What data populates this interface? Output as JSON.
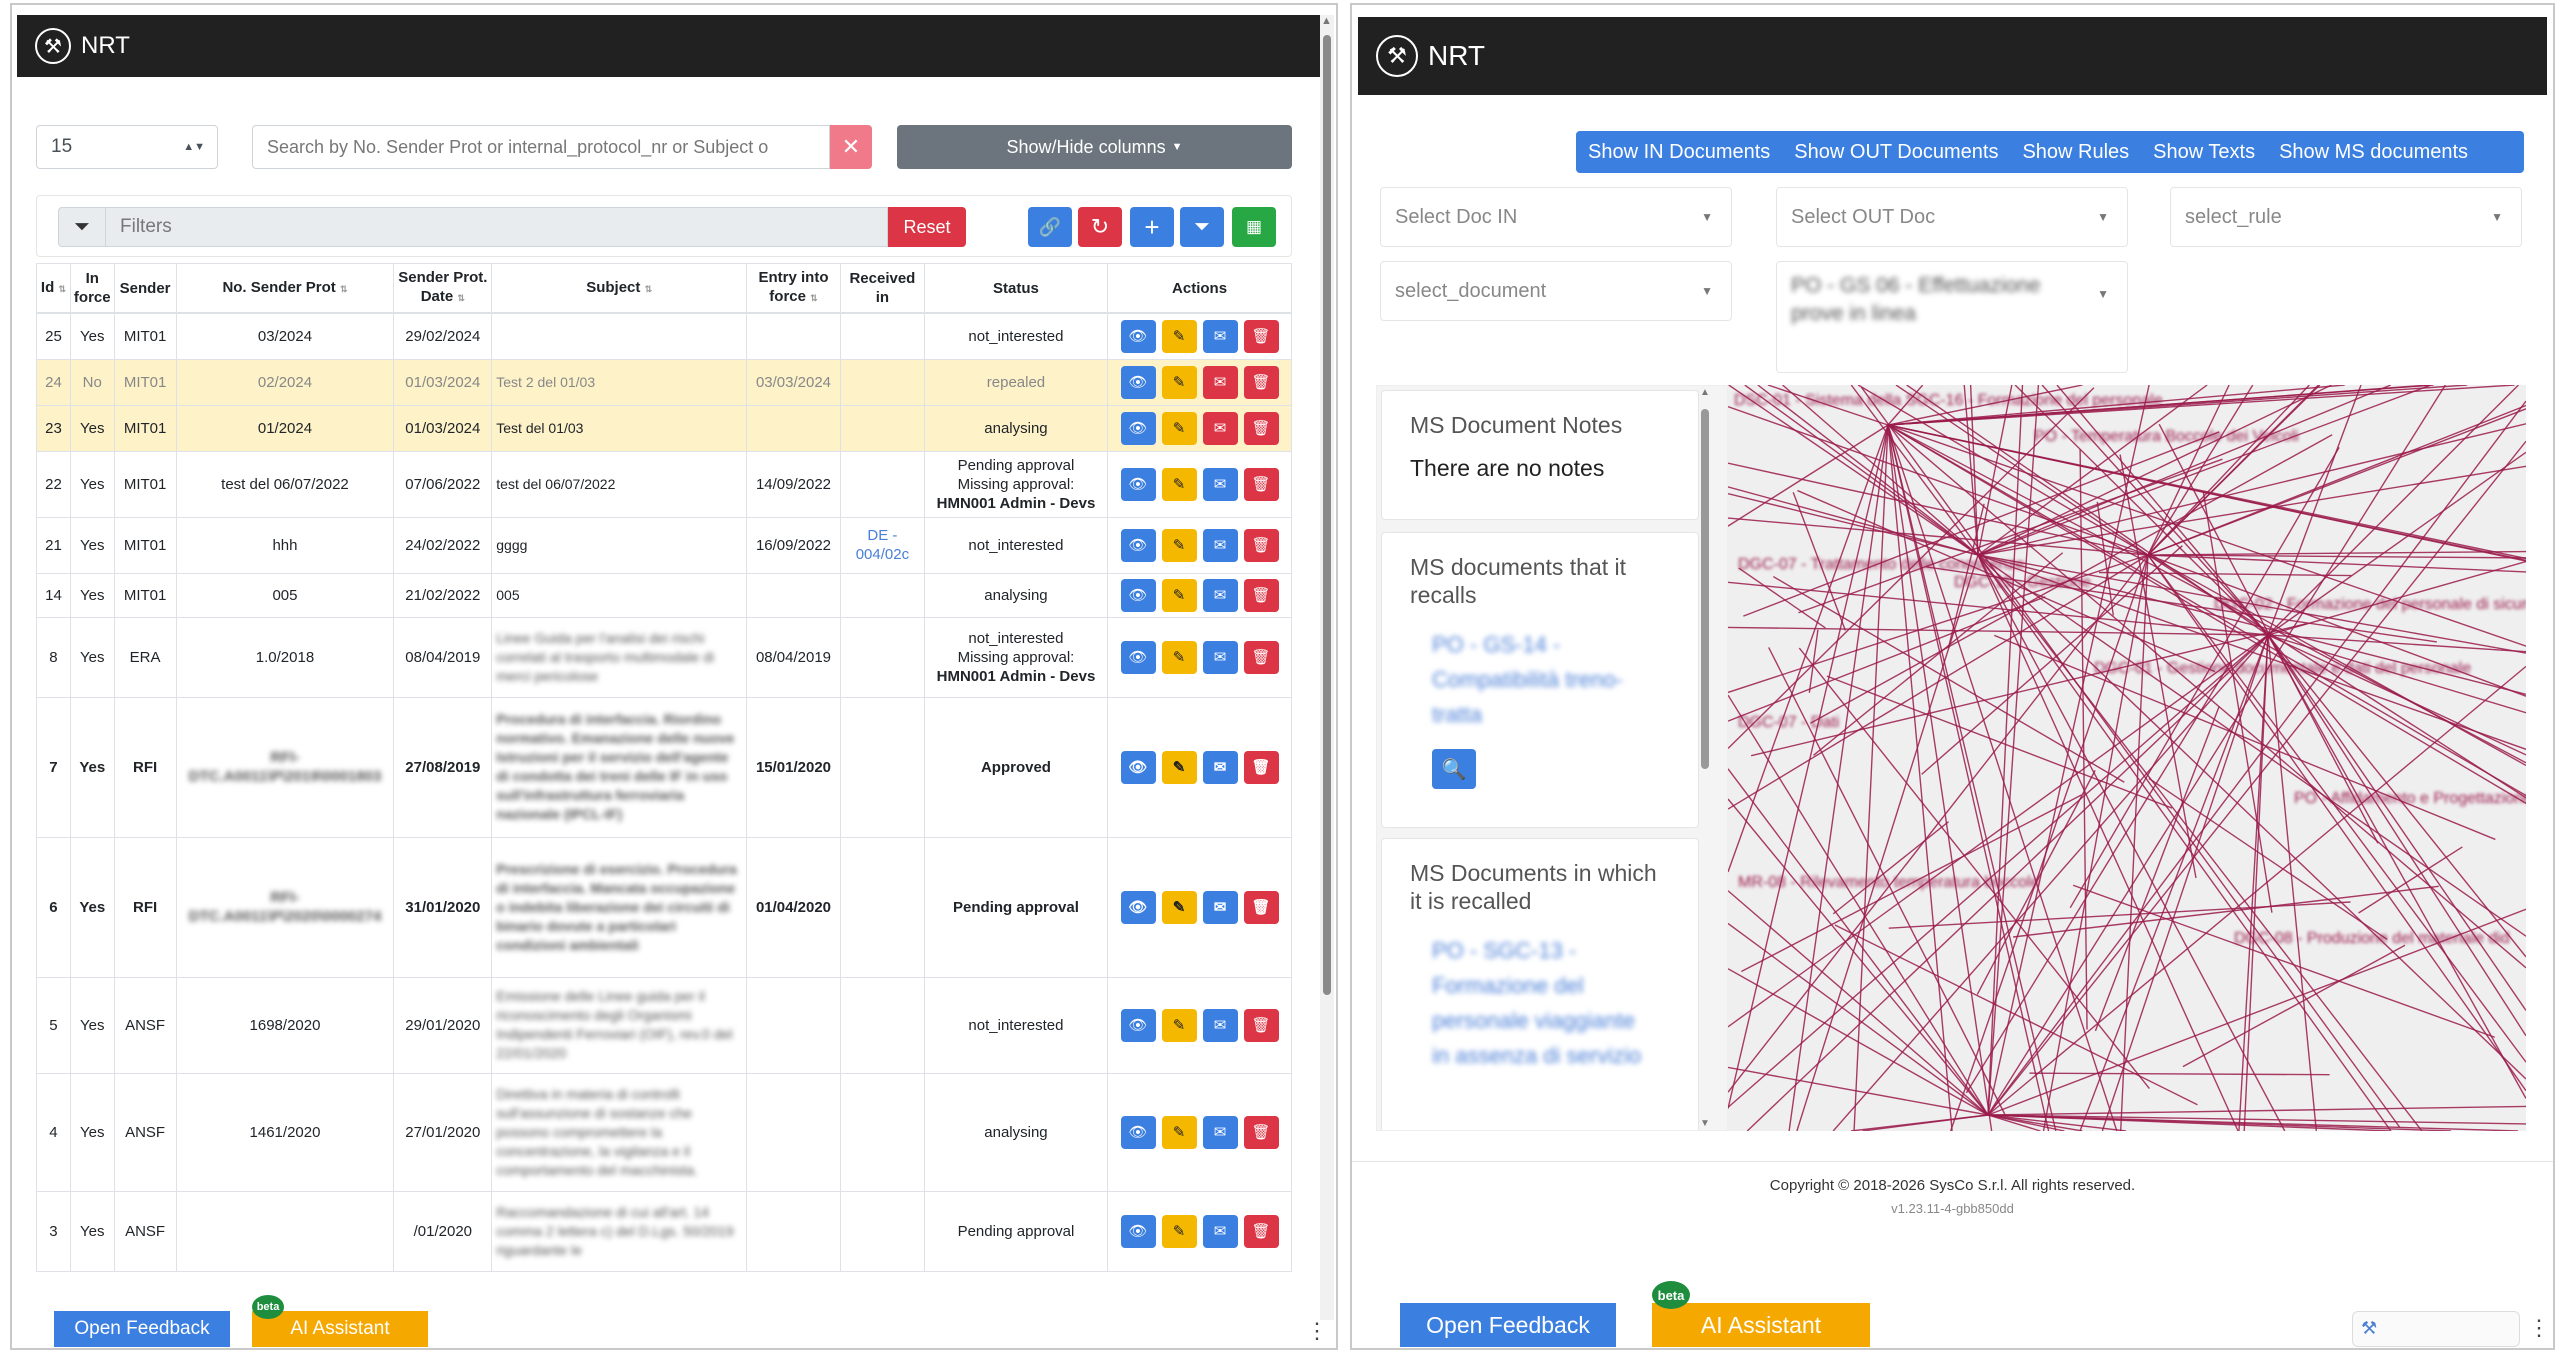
{
  "left": {
    "brand": "NRT",
    "page_size": "15",
    "search_placeholder": "Search by No. Sender Prot or internal_protocol_nr or Subject o",
    "show_hide_label": "Show/Hide columns",
    "filters_placeholder": "Filters",
    "reset_label": "Reset",
    "columns": [
      "Id",
      "In force",
      "Sender",
      "No. Sender Prot",
      "Sender Prot. Date",
      "Subject",
      "Entry into force",
      "Received in",
      "Status",
      "Actions"
    ],
    "rows": [
      {
        "id": "25",
        "inforce": "Yes",
        "sender": "MIT01",
        "prot": "03/2024",
        "date": "29/02/2024",
        "subject": "",
        "entry": "",
        "received": "",
        "status": "not_interested",
        "status2": "",
        "status3": ""
      },
      {
        "id": "24",
        "inforce": "No",
        "sender": "MIT01",
        "prot": "02/2024",
        "date": "01/03/2024",
        "subject": "Test 2 del 01/03",
        "entry": "03/03/2024",
        "received": "",
        "status": "repealed",
        "status2": "",
        "status3": ""
      },
      {
        "id": "23",
        "inforce": "Yes",
        "sender": "MIT01",
        "prot": "01/2024",
        "date": "01/03/2024",
        "subject": "Test del 01/03",
        "entry": "",
        "received": "",
        "status": "analysing",
        "status2": "",
        "status3": ""
      },
      {
        "id": "22",
        "inforce": "Yes",
        "sender": "MIT01",
        "prot": "test del 06/07/2022",
        "date": "07/06/2022",
        "subject": "test del 06/07/2022",
        "entry": "14/09/2022",
        "received": "",
        "status": "Pending approval",
        "status2": "Missing approval:",
        "status3": "HMN001 Admin - Devs"
      },
      {
        "id": "21",
        "inforce": "Yes",
        "sender": "MIT01",
        "prot": "hhh",
        "date": "24/02/2022",
        "subject": "gggg",
        "entry": "16/09/2022",
        "received": "DE - 004/02c",
        "status": "not_interested",
        "status2": "",
        "status3": ""
      },
      {
        "id": "14",
        "inforce": "Yes",
        "sender": "MIT01",
        "prot": "005",
        "date": "21/02/2022",
        "subject": "005",
        "entry": "",
        "received": "",
        "status": "analysing",
        "status2": "",
        "status3": ""
      },
      {
        "id": "8",
        "inforce": "Yes",
        "sender": "ERA",
        "prot": "1.0/2018",
        "date": "08/04/2019",
        "subject": "Linee Guida per l'analisi dei rischi correlati al trasporto multimodale di merci pericolose",
        "entry": "08/04/2019",
        "received": "",
        "status": "not_interested",
        "status2": "Missing approval:",
        "status3": "HMN001 Admin - Devs"
      },
      {
        "id": "7",
        "inforce": "Yes",
        "sender": "RFI",
        "prot": "RFI-DTC.A0011\\P\\2019\\0001803",
        "date": "27/08/2019",
        "subject": "Procedura di interfaccia. Riordino normativo. Emanazione delle nuove Istruzioni per il servizio dell'agente di condotta dei treni delle IF in uso sull'infrastruttura ferroviaria nazionale (IPCL-IF)",
        "entry": "15/01/2020",
        "received": "",
        "status": "Approved",
        "status2": "",
        "status3": ""
      },
      {
        "id": "6",
        "inforce": "Yes",
        "sender": "RFI",
        "prot": "RFI-DTC.A0011\\P\\2020\\0000274",
        "date": "31/01/2020",
        "subject": "Prescrizione di esercizio. Procedura di interfaccia. Mancata occupazione o indebita liberazione dei circuiti di binario dovute a particolari condizioni ambientali",
        "entry": "01/04/2020",
        "received": "",
        "status": "Pending approval",
        "status2": "",
        "status3": ""
      },
      {
        "id": "5",
        "inforce": "Yes",
        "sender": "ANSF",
        "prot": "1698/2020",
        "date": "29/01/2020",
        "subject": "Emissione delle Linee guida per il riconoscimento degli Organismi Indipendenti Ferroviari (OIF), rev.0 del 22/01/2020",
        "entry": "",
        "received": "",
        "status": "not_interested",
        "status2": "",
        "status3": ""
      },
      {
        "id": "4",
        "inforce": "Yes",
        "sender": "ANSF",
        "prot": "1461/2020",
        "date": "27/01/2020",
        "subject": "Direttiva in materia di controlli sull'assunzione di sostanze che possono compromettere la concentrazione, la vigilanza e il comportamento del macchinista.",
        "entry": "",
        "received": "",
        "status": "analysing",
        "status2": "",
        "status3": ""
      },
      {
        "id": "3",
        "inforce": "Yes",
        "sender": "ANSF",
        "prot": "",
        "date": "/01/2020",
        "subject": "Raccomandazione di cui all'art. 14 comma 2 lettera c) del D.Lgs. 50/2019 riguardante le",
        "entry": "",
        "received": "",
        "status": "Pending approval",
        "status2": "",
        "status3": ""
      }
    ],
    "feedback_label": "Open Feedback",
    "ai_label": "AI Assistant",
    "beta_label": "beta"
  },
  "right": {
    "brand": "NRT",
    "tabs": [
      "Show IN Documents",
      "Show OUT Documents",
      "Show Rules",
      "Show Texts",
      "Show MS documents"
    ],
    "select_doc_in": "Select Doc IN",
    "select_out_doc": "Select OUT Doc",
    "select_rule": "select_rule",
    "select_document": "select_document",
    "selected_doc": "PO - GS 06 - Effettuazione prove in linea",
    "notes_title": "MS Document Notes",
    "notes_text": "There are no notes",
    "recalls_title": "MS documents that it recalls",
    "recalls_link": "PO - GS-14 - Compatibilità treno-tratta",
    "recalled_title": "MS Documents in which it is recalled",
    "recalled_link": "PO - SGC-13 - Formazione del personale viaggiante in assenza di servizio",
    "graph_labels": [
      "DSC-01 - Sistema della SGC-16 - Formazione del personale",
      "PO - Temperatura Boccole dei Veicoli",
      "DGC-07 - Trattamento delle conoscenze",
      "DGC-15 - Gestione",
      "DGC-02 - Formazione del personale di sicurezza",
      "DGC-01 - Gestione documentale e dati del personale",
      "DGC-07 - Dati",
      "PO - Affidamento e Progettazione Programmi Formativi",
      "MR-08 - Rilevamento temperatura boccole",
      "DGC-08 - Produzione del materiale did"
    ],
    "copyright": "Copyright © 2018-2026 SysCo S.r.l. All rights reserved.",
    "version": "v1.23.11-4-gbb850dd",
    "feedback_label": "Open Feedback",
    "ai_label": "AI Assistant",
    "beta_label": "beta"
  },
  "colors": {
    "navbar": "#212121",
    "primary": "#3b7fe0",
    "danger": "#dc3545",
    "warning": "#f5b800",
    "highlight_row": "#fdf2c8",
    "graph_edges": "#9b1b4b"
  }
}
